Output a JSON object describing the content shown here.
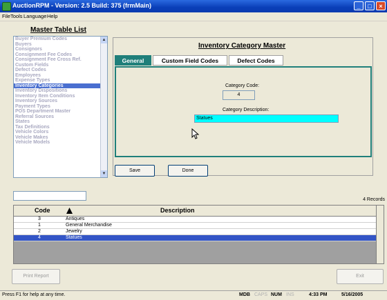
{
  "window": {
    "title": "AuctionRPM - Version: 2.5 Build: 375    (frmMain)"
  },
  "menu": [
    "File",
    "Tools",
    "Language",
    "Help"
  ],
  "left_panel": {
    "heading": "Master Table List",
    "items": [
      {
        "label": "Buyer Premium Codes",
        "selected": false
      },
      {
        "label": "Buyers",
        "selected": false
      },
      {
        "label": "Consignors",
        "selected": false
      },
      {
        "label": "Consignment Fee Codes",
        "selected": false
      },
      {
        "label": "Consignment Fee Cross Ref.",
        "selected": false
      },
      {
        "label": "Custom Fields",
        "selected": false
      },
      {
        "label": "Defect Codes",
        "selected": false
      },
      {
        "label": "Employees",
        "selected": false
      },
      {
        "label": "Expense Types",
        "selected": false
      },
      {
        "label": "Inventory Categories",
        "selected": true
      },
      {
        "label": "Inventory Dispositions",
        "selected": false
      },
      {
        "label": "Inventory Item Conditions",
        "selected": false
      },
      {
        "label": "Inventory Sources",
        "selected": false
      },
      {
        "label": "Payment Types",
        "selected": false
      },
      {
        "label": "POS Department Master",
        "selected": false
      },
      {
        "label": "Referral Sources",
        "selected": false
      },
      {
        "label": "States",
        "selected": false
      },
      {
        "label": "Tax Definitions",
        "selected": false
      },
      {
        "label": "Vehicle Colors",
        "selected": false
      },
      {
        "label": "Vehicle Makes",
        "selected": false
      },
      {
        "label": "Vehicle Models",
        "selected": false
      }
    ]
  },
  "detail": {
    "heading": "Inventory Category Master",
    "tabs": [
      {
        "label": "General",
        "active": true
      },
      {
        "label": "Custom Field Codes",
        "active": false
      },
      {
        "label": "Defect Codes",
        "active": false
      }
    ],
    "code_label": "Category Code:",
    "code_value": "4",
    "desc_label": "Category Description:",
    "desc_value": "Statues",
    "save_label": "Save",
    "done_label": "Done"
  },
  "search": {
    "value": ""
  },
  "records_label": "4 Records",
  "grid": {
    "columns": [
      "Code",
      "Description"
    ],
    "rows": [
      {
        "code": "3",
        "description": "Antiques",
        "selected": false
      },
      {
        "code": "1",
        "description": "General Merchandise",
        "selected": false
      },
      {
        "code": "2",
        "description": "Jewelry",
        "selected": false
      },
      {
        "code": "4",
        "description": "Statues",
        "selected": true
      }
    ]
  },
  "footer": {
    "print_label": "Print Report",
    "exit_label": "Exit"
  },
  "status": {
    "help": "Press F1 for help at any time.",
    "mdb": "MDB",
    "caps": "CAPS",
    "num": "NUM",
    "ins": "INS",
    "time": "4:33 PM",
    "date": "5/16/2005"
  },
  "colors": {
    "title_blue": "#0a3fb8",
    "tab_teal": "#1f7f7a",
    "selection": "#4a6fd0",
    "desc_field": "#00ffff"
  }
}
